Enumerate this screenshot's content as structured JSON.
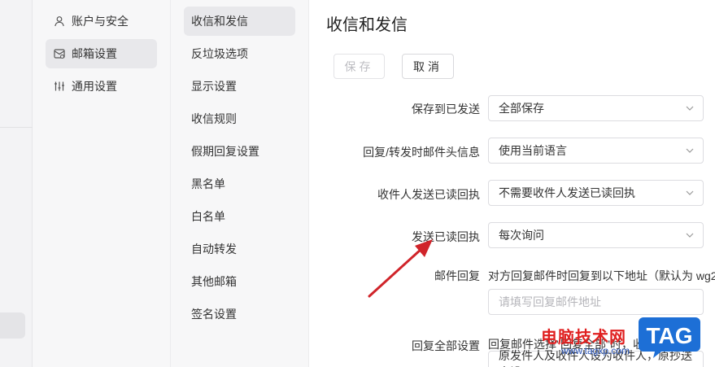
{
  "nav_primary": {
    "items": [
      {
        "label": "账户与安全",
        "icon": "user-icon"
      },
      {
        "label": "邮箱设置",
        "icon": "mailbox-settings-icon",
        "active": true
      },
      {
        "label": "通用设置",
        "icon": "sliders-icon"
      }
    ]
  },
  "nav_secondary": {
    "items": [
      {
        "label": "收信和发信",
        "active": true
      },
      {
        "label": "反垃圾选项"
      },
      {
        "label": "显示设置"
      },
      {
        "label": "收信规则"
      },
      {
        "label": "假期回复设置"
      },
      {
        "label": "黑名单"
      },
      {
        "label": "白名单"
      },
      {
        "label": "自动转发"
      },
      {
        "label": "其他邮箱"
      },
      {
        "label": "签名设置"
      }
    ]
  },
  "main": {
    "title": "收信和发信",
    "save_label": "保存",
    "cancel_label": "取消",
    "rows": {
      "save_sent": {
        "label": "保存到已发送",
        "value": "全部保存"
      },
      "reply_header": {
        "label": "回复/转发时邮件头信息",
        "value": "使用当前语言"
      },
      "recipient_receipt": {
        "label": "收件人发送已读回执",
        "value": "不需要收件人发送已读回执"
      },
      "send_receipt": {
        "label": "发送已读回执",
        "value": "每次询问"
      },
      "reply_to": {
        "label": "邮件回复",
        "desc": "对方回复邮件时回复到以下地址（默认为 wg2",
        "placeholder": "请填写回复邮件地址"
      },
      "reply_all": {
        "label": "回复全部设置",
        "desc": "回复邮件选择\"回复全部\"时，收件",
        "value": "原发件人及收件人设为收件人，原抄送人设"
      }
    }
  },
  "watermark": {
    "text": "电脑技术网",
    "url": "www.tagxp.com",
    "logo_text": "TAG"
  },
  "colors": {
    "arrow": "#d0242a",
    "active_bg": "#e8e8eb",
    "watermark_red": "#e02020",
    "logo_blue": "#1d6fd6"
  }
}
